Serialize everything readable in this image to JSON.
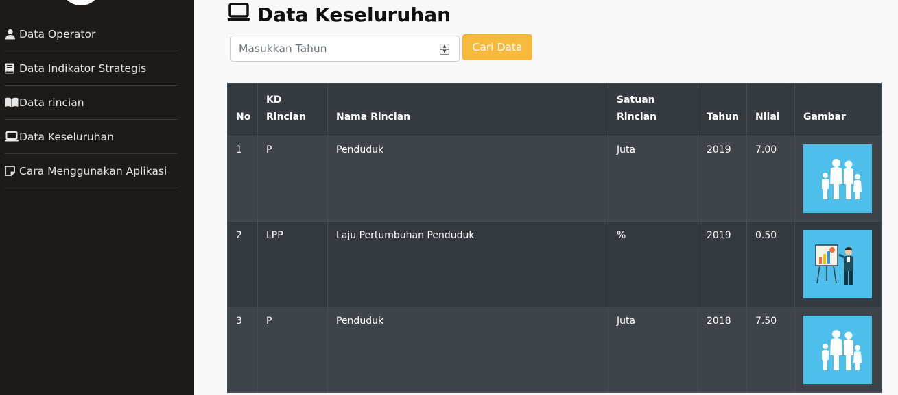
{
  "sidebar": {
    "items": [
      {
        "label": "Data Operator",
        "icon": "user-icon"
      },
      {
        "label": "Data Indikator Strategis",
        "icon": "book-icon"
      },
      {
        "label": "Data rincian",
        "icon": "book-open-icon"
      },
      {
        "label": "Data Keseluruhan",
        "icon": "laptop-icon"
      },
      {
        "label": "Cara Menggunakan Aplikasi",
        "icon": "sticky-note-icon"
      }
    ]
  },
  "header": {
    "title": "Data Keseluruhan",
    "icon": "laptop-icon"
  },
  "search": {
    "placeholder": "Masukkan Tahun",
    "value": "",
    "button_label": "Cari Data"
  },
  "table": {
    "headers": {
      "no": "No",
      "kd_line1": "KD",
      "kd_line2": "Rincian",
      "nama": "Nama Rincian",
      "satuan_line1": "Satuan",
      "satuan_line2": "Rincian",
      "tahun": "Tahun",
      "nilai": "Nilai",
      "gambar": "Gambar"
    },
    "rows": [
      {
        "no": "1",
        "kd": "P",
        "nama": "Penduduk",
        "satuan": "Juta",
        "tahun": "2019",
        "nilai": "7.00",
        "image": "family-illustration"
      },
      {
        "no": "2",
        "kd": "LPP",
        "nama": "Laju Pertumbuhan Penduduk",
        "satuan": "%",
        "tahun": "2019",
        "nilai": "0.50",
        "image": "presentation-illustration"
      },
      {
        "no": "3",
        "kd": "P",
        "nama": "Penduduk",
        "satuan": "Juta",
        "tahun": "2018",
        "nilai": "7.50",
        "image": "family-illustration"
      }
    ]
  },
  "colors": {
    "sidebar_bg": "#1e1a17",
    "accent": "#f6b93b",
    "table_header": "#343a40",
    "table_row_odd": "#3e444a",
    "image_bg": "#4ebeea"
  }
}
